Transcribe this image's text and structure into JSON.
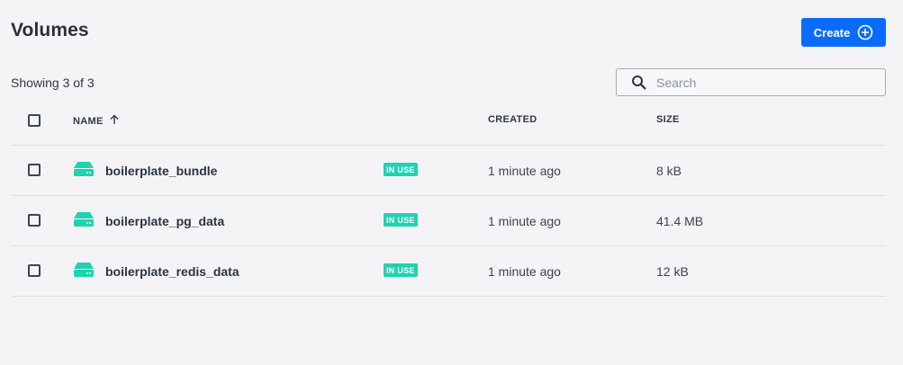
{
  "header": {
    "title": "Volumes",
    "create_label": "Create"
  },
  "toolbar": {
    "showing": "Showing 3 of 3",
    "search_placeholder": "Search"
  },
  "table": {
    "columns": {
      "name": "NAME",
      "created": "CREATED",
      "size": "SIZE"
    },
    "sort": {
      "column": "name",
      "direction": "ascending"
    },
    "rows": [
      {
        "name": "boilerplate_bundle",
        "badge": "IN USE",
        "created": "1 minute ago",
        "size": "8 kB"
      },
      {
        "name": "boilerplate_pg_data",
        "badge": "IN USE",
        "created": "1 minute ago",
        "size": "41.4 MB"
      },
      {
        "name": "boilerplate_redis_data",
        "badge": "IN USE",
        "created": "1 minute ago",
        "size": "12 kB"
      }
    ]
  },
  "colors": {
    "primary": "#0a6cff",
    "badge": "#1fd3b0",
    "volume_icon": "#1fd3b0"
  },
  "icons": {
    "create": "plus-circle-icon",
    "search": "search-icon",
    "sort": "arrow-up-icon",
    "volume": "volume-drive-icon"
  }
}
